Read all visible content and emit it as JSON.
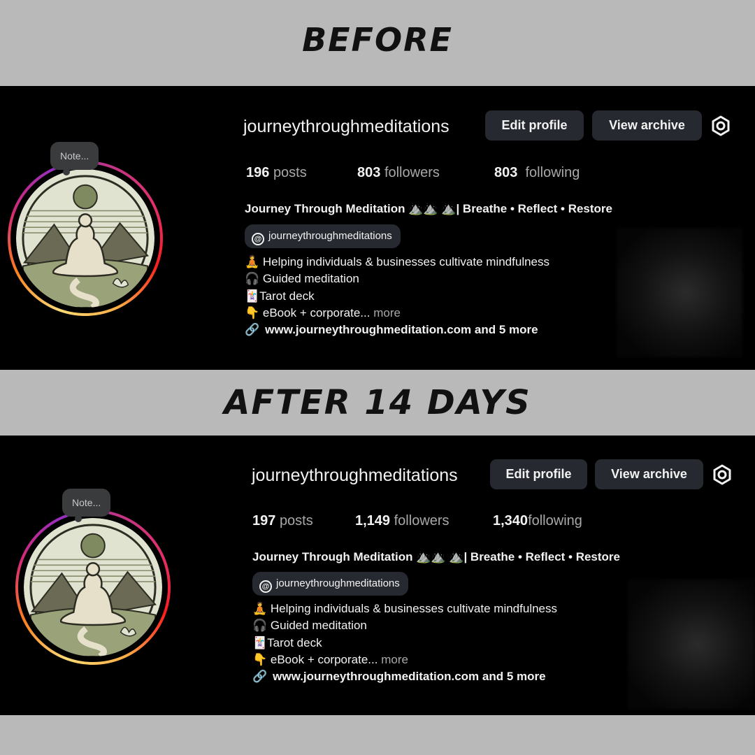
{
  "headings": {
    "before": "Before",
    "after": "After 14 days"
  },
  "before": {
    "note": "Note...",
    "username": "journeythroughmeditations",
    "edit_profile": "Edit profile",
    "view_archive": "View archive",
    "posts_count": "196",
    "posts_label": "posts",
    "followers_count": "803",
    "followers_label": "followers",
    "following_count": "803",
    "following_label": "following",
    "full_name": "Journey Through Meditation ⛰️⛰️ ⛰️| Breathe • Reflect • Restore",
    "threads_handle": "journeythroughmeditations",
    "bio_1": "🧘 Helping individuals & businesses cultivate mindfulness",
    "bio_2": "🎧 Guided meditation",
    "bio_3": "🃏Tarot deck",
    "bio_4": "👇 eBook + corporate...",
    "bio_more": "more",
    "link": "www.journeythroughmeditation.com and 5 more"
  },
  "after": {
    "note": "Note...",
    "username": "journeythroughmeditations",
    "edit_profile": "Edit profile",
    "view_archive": "View archive",
    "posts_count": "197",
    "posts_label": "posts",
    "followers_count": "1,149",
    "followers_label": "followers",
    "following_count": "1,340",
    "following_label": "following",
    "full_name": "Journey Through Meditation ⛰️⛰️ ⛰️| Breathe • Reflect • Restore",
    "threads_handle": "journeythroughmeditations",
    "bio_1": "🧘 Helping individuals & businesses cultivate mindfulness",
    "bio_2": "🎧 Guided meditation",
    "bio_3": "🃏Tarot deck",
    "bio_4": "👇 eBook + corporate...",
    "bio_more": "more",
    "link": "www.journeythroughmeditation.com and 5 more"
  }
}
